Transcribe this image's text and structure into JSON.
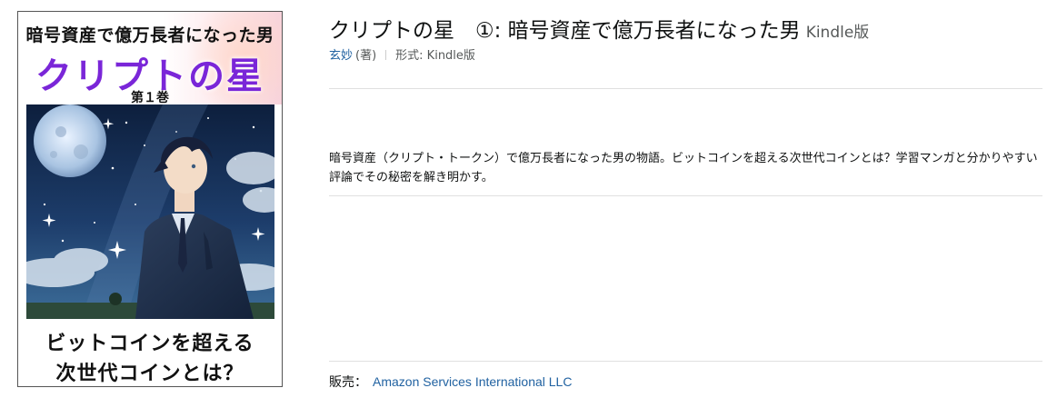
{
  "cover": {
    "subtitle": "暗号資産で億万長者になった男",
    "title": "クリプトの星",
    "volume": "第１巻",
    "catch_line1": "ビットコインを超える",
    "catch_line2": "次世代コインとは？"
  },
  "product": {
    "title": "クリプトの星　①: 暗号資産で億万長者になった男",
    "format_suffix": "Kindle版",
    "author": "玄妙",
    "author_role": "(著)",
    "format_label": "形式: Kindle版",
    "description": "暗号資産（クリプト・トークン）で億万長者になった男の物語。ビットコインを超える次世代コインとは？学習マンガと分かりやすい評論でその秘密を解き明かす。",
    "seller_label": "販売：",
    "seller_name": "Amazon Services International LLC"
  }
}
